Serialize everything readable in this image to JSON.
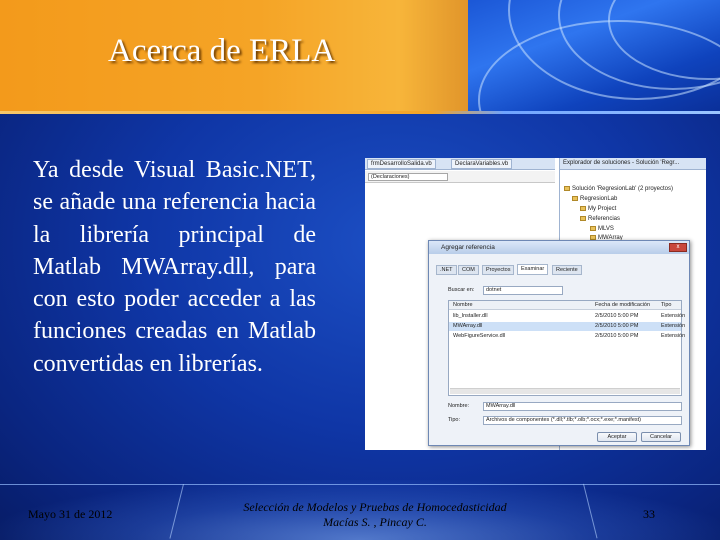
{
  "slide": {
    "title": "Acerca de ERLA",
    "body": "Ya desde Visual Basic.NET, se añade una referencia hacia la librería principal de Matlab MWArray.dll, para con esto poder acceder a las funciones creadas en Matlab convertidas en librerías.",
    "colors": {
      "header_orange": "#f5a426",
      "background_blue": "#0f36a6",
      "title_text": "#ffffff",
      "body_text": "#ffffff"
    }
  },
  "screenshot": {
    "editor_tabs": [
      "frmDesarrolloSalida.vb",
      "DeclaraVariables.vb"
    ],
    "declarations_field": "(Declaraciones)",
    "solution_panel": {
      "header": "Explorador de soluciones - Solución 'Regr...",
      "rows": [
        "Solución 'RegresionLab' (2 proyectos)",
        "RegresionLab",
        "My Project",
        "Referencias",
        "MLVS",
        "MWArray"
      ]
    },
    "dialog": {
      "title": "Agregar referencia",
      "close_label": "x",
      "tabs": [
        ".NET",
        "COM",
        "Proyectos",
        "Examinar",
        "Reciente"
      ],
      "active_tab": "Examinar",
      "look_in_label": "Buscar en:",
      "look_in_value": "dotnet",
      "columns": [
        "Nombre",
        "Fecha de modificación",
        "Tipo"
      ],
      "files": [
        {
          "name": "lib_Installer.dll",
          "date": "2/5/2010 5:00 PM",
          "type": "Extensión"
        },
        {
          "name": "MWArray.dll",
          "date": "2/5/2010 5:00 PM",
          "type": "Extensión"
        },
        {
          "name": "WebFigureService.dll",
          "date": "2/5/2010 5:00 PM",
          "type": "Extensión"
        }
      ],
      "selected_file": "MWArray.dll",
      "filename_label": "Nombre:",
      "filename_value": "MWArray.dll",
      "type_label": "Tipo:",
      "type_value": "Archivos de componentes (*.dll;*.tlb;*.olb;*.ocx;*.exe;*.manifest)",
      "ok_label": "Aceptar",
      "cancel_label": "Cancelar"
    }
  },
  "footer": {
    "date": "Mayo 31 de 2012",
    "center_line1": "Selección de Modelos y Pruebas de Homocedasticidad",
    "center_line2": "Macías S. , Pincay C.",
    "page_number": "33"
  }
}
